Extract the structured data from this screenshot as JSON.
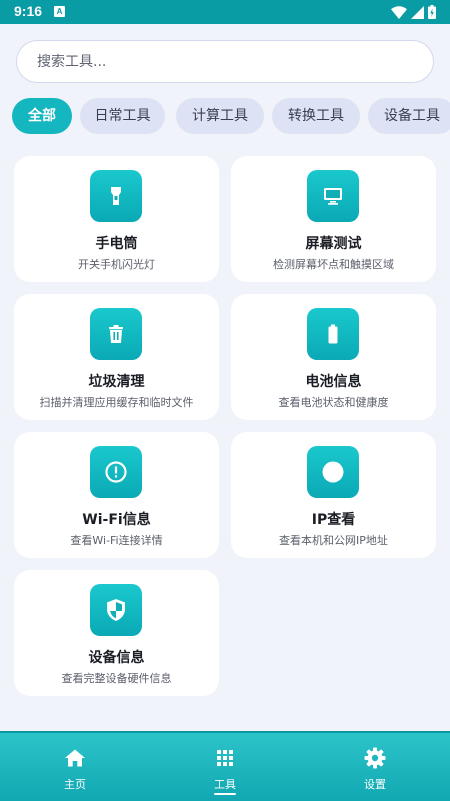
{
  "status_bar": {
    "time": "9:16",
    "notification_glyph": "A"
  },
  "search": {
    "placeholder": "搜索工具..."
  },
  "categories": [
    {
      "label": "全部",
      "active": true
    },
    {
      "label": "日常工具",
      "active": false
    },
    {
      "label": "计算工具",
      "active": false
    },
    {
      "label": "转换工具",
      "active": false
    },
    {
      "label": "设备工具",
      "active": false
    }
  ],
  "tools": [
    {
      "title": "手电筒",
      "desc": "开关手机闪光灯",
      "icon": "flashlight-icon"
    },
    {
      "title": "屏幕测试",
      "desc": "检测屏幕坏点和触摸区域",
      "icon": "monitor-icon"
    },
    {
      "title": "垃圾清理",
      "desc": "扫描并清理应用缓存和临时文件",
      "icon": "trash-icon"
    },
    {
      "title": "电池信息",
      "desc": "查看电池状态和健康度",
      "icon": "battery-icon"
    },
    {
      "title": "Wi-Fi信息",
      "desc": "查看Wi-Fi连接详情",
      "icon": "alert-circle-icon"
    },
    {
      "title": "IP查看",
      "desc": "查看本机和公网IP地址",
      "icon": "circle-icon"
    },
    {
      "title": "设备信息",
      "desc": "查看完整设备硬件信息",
      "icon": "shield-icon"
    }
  ],
  "bottom_nav": [
    {
      "label": "主页",
      "icon": "home-icon",
      "active": false
    },
    {
      "label": "工具",
      "icon": "grid-icon",
      "active": true
    },
    {
      "label": "设置",
      "icon": "gear-icon",
      "active": false
    }
  ],
  "colors": {
    "accent": "#14b7c0",
    "status_bar": "#0a9ca4",
    "background": "#f1f3fb"
  }
}
